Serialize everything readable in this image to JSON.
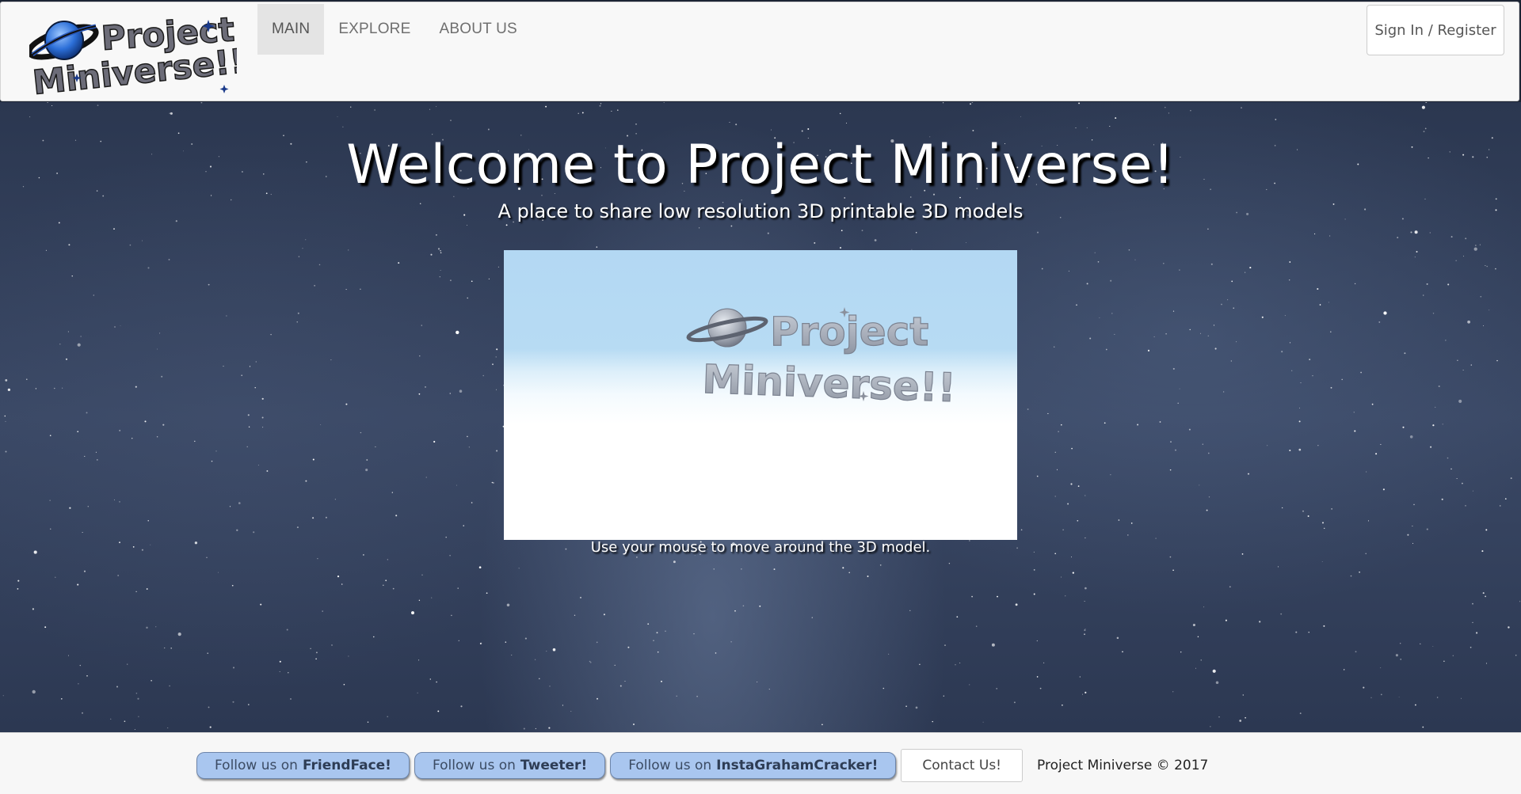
{
  "header": {
    "logo_line1": "Project",
    "logo_line2": "Miniverse!!",
    "nav": [
      {
        "label": "MAIN",
        "active": true
      },
      {
        "label": "EXPLORE",
        "active": false
      },
      {
        "label": "ABOUT US",
        "active": false
      }
    ],
    "signin_label": "Sign In / Register"
  },
  "hero": {
    "title": "Welcome to Project Miniverse!",
    "subtitle": "A place to share low resolution 3D printable 3D models",
    "viewer": {
      "model_text_line1": "Project",
      "model_text_line2": "Miniverse!!"
    },
    "hint": "Use your mouse to move around the 3D model."
  },
  "footer": {
    "social": [
      {
        "prefix": "Follow us on",
        "name": "FriendFace!"
      },
      {
        "prefix": "Follow us on",
        "name": "Tweeter!"
      },
      {
        "prefix": "Follow us on",
        "name": "InstaGrahamCracker!"
      }
    ],
    "contact_label": "Contact Us!",
    "copyright": "Project Miniverse © 2017"
  },
  "colors": {
    "navbar_bg": "#f8f8f8",
    "active_nav_bg": "#e4e4e4",
    "social_button_bg": "#a9c6ef",
    "sky_top": "#b3d8f3",
    "night_sky": "#2b3750"
  },
  "icons": {
    "logo_planet": "ringed-planet-icon",
    "model_planet": "ringed-planet-icon"
  }
}
